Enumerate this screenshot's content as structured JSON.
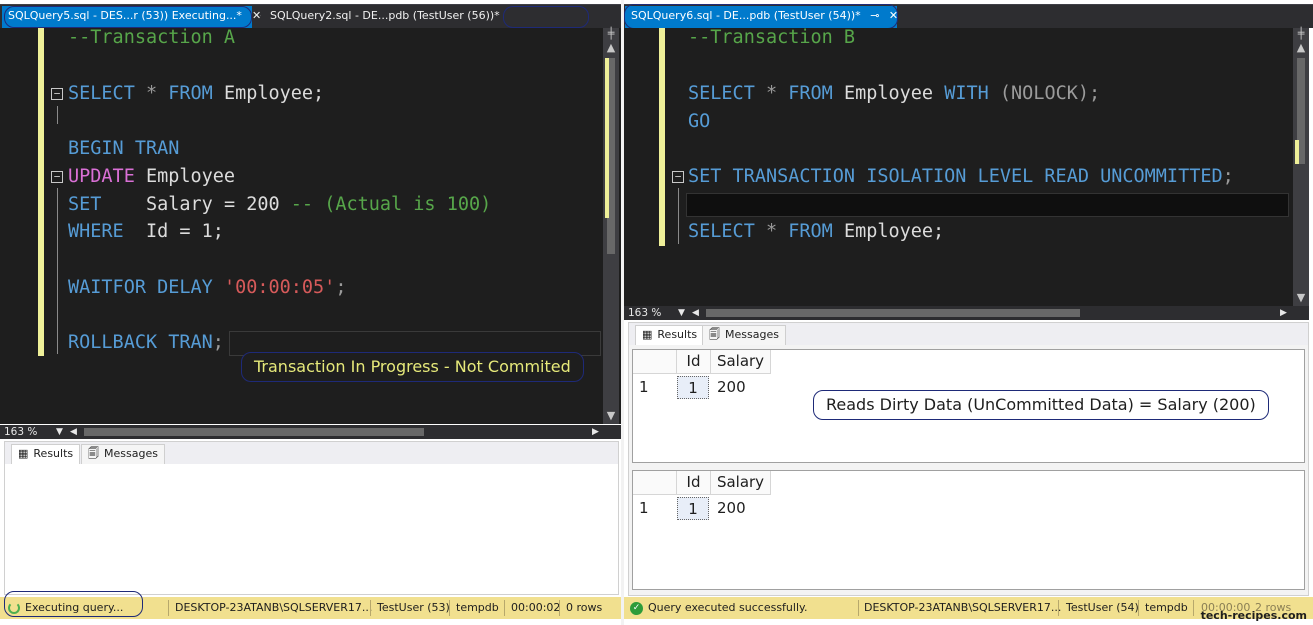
{
  "left": {
    "tabs": [
      {
        "label": "SQLQuery5.sql - DES...r (53)) Executing...*",
        "pin": "⊸"
      },
      {
        "label": "SQLQuery2.sql - DE...pdb (TestUser (56))*"
      }
    ],
    "close_glyph": "✕",
    "code": {
      "l1": "--Transaction A",
      "l3_kw": "SELECT",
      "l3_star": "*",
      "l3_kw2": "FROM",
      "l3_rest": "Employee;",
      "l5": "BEGIN TRAN",
      "l6_kw": "UPDATE",
      "l6_rest": "Employee",
      "l7_kw": "SET",
      "l7_mid": "Salary = 200",
      "l7_cm": "-- (Actual is 100)",
      "l8_kw": "WHERE",
      "l8_rest": "Id = 1;",
      "l10_kw": "WAITFOR DELAY",
      "l10_str": "'00:00:05'",
      "l10_end": ";",
      "l12_kw": "ROLLBACK TRAN",
      "l12_end": ";"
    },
    "zoom": "163 %",
    "result_tabs": {
      "results": "Results",
      "messages": "Messages"
    },
    "callout": "Transaction In Progress - Not Commited",
    "status": {
      "state": "Executing query...",
      "server": "DESKTOP-23ATANB\\SQLSERVER17...",
      "user": "TestUser (53)",
      "db": "tempdb",
      "time": "00:00:02",
      "rows": "0 rows"
    }
  },
  "right": {
    "tab": {
      "label": "SQLQuery6.sql - DE...pdb (TestUser (54))*",
      "pin": "⊸",
      "close": "✕"
    },
    "code": {
      "l1": "--Transaction B",
      "l3_kw": "SELECT",
      "l3_star": "*",
      "l3_kw2": "FROM",
      "l3_mid": "Employee",
      "l3_kw3": "WITH",
      "l3_rest": "(NOLOCK);",
      "l4": "GO",
      "l6": "SET TRANSACTION ISOLATION LEVEL READ UNCOMMITTED",
      "l6_end": ";",
      "l8_kw": "SELECT",
      "l8_star": "*",
      "l8_kw2": "FROM",
      "l8_rest": "Employee;"
    },
    "zoom": "163 %",
    "result_tabs": {
      "results": "Results",
      "messages": "Messages"
    },
    "grid1": {
      "columns": [
        "Id",
        "Salary"
      ],
      "rownum": "1",
      "id": "1",
      "salary": "200"
    },
    "grid2": {
      "columns": [
        "Id",
        "Salary"
      ],
      "rownum": "1",
      "id": "1",
      "salary": "200"
    },
    "callout": "Reads Dirty Data (UnCommitted Data) = Salary (200)",
    "status": {
      "state": "Query executed successfully.",
      "server": "DESKTOP-23ATANB\\SQLSERVER17...",
      "user": "TestUser (54)",
      "db": "tempdb",
      "time": "00:00:00",
      "rows": "2 rows"
    }
  },
  "watermark": "tech-recipes.com",
  "colors": {
    "accent": "#007acc",
    "status": "#f1e08f",
    "keyword": "#569cd6",
    "comment": "#57a64a",
    "string": "#d65a5a"
  }
}
